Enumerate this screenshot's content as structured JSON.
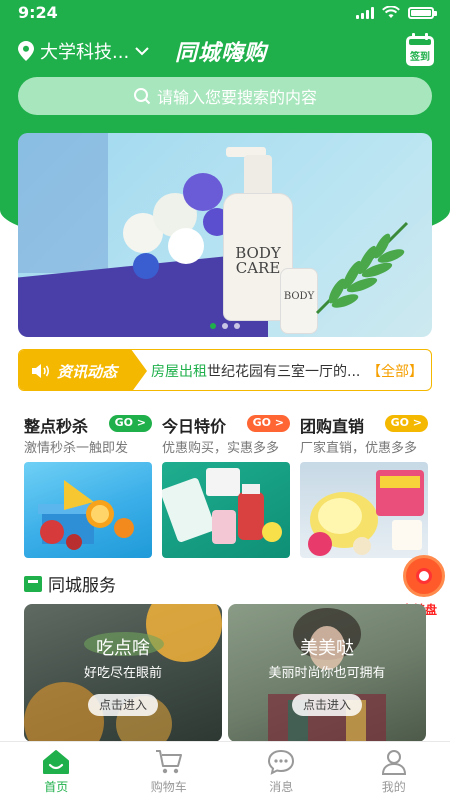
{
  "status_bar": {
    "time": "9:24"
  },
  "header": {
    "location": "大学科技...",
    "app_title": "同城嗨购",
    "signin_label": "签到"
  },
  "search": {
    "placeholder": "请输入您要搜索的内容"
  },
  "banner": {
    "product_label_1": "BODY CARE",
    "product_label_2": "BODY",
    "slide_count": 3,
    "active_slide": 1
  },
  "news": {
    "tag": "资讯动态",
    "highlight": "房屋出租",
    "text": "世纪花园有三室一厅的...",
    "more": "【全部】"
  },
  "promos": [
    {
      "title": "整点秒杀",
      "go": "GO >",
      "subtitle": "激情秒杀一触即发",
      "go_color": "#20b04b"
    },
    {
      "title": "今日特价",
      "go": "GO >",
      "subtitle": "优惠购买，实惠多多",
      "go_color": "#ff6633"
    },
    {
      "title": "团购直销",
      "go": "GO >",
      "subtitle": "厂家直销，优惠多多",
      "go_color": "#f5b800"
    }
  ],
  "service": {
    "title": "同城服务",
    "cards": [
      {
        "title": "吃点啥",
        "subtitle": "好吃尽在眼前",
        "button": "点击进入"
      },
      {
        "title": "美美哒",
        "subtitle": "美丽时尚你也可拥有",
        "button": "点击进入"
      }
    ]
  },
  "float_widget": {
    "label": "大转盘"
  },
  "tabbar": {
    "items": [
      {
        "label": "首页",
        "icon": "home-icon",
        "active": true
      },
      {
        "label": "购物车",
        "icon": "cart-icon",
        "active": false
      },
      {
        "label": "消息",
        "icon": "message-icon",
        "active": false
      },
      {
        "label": "我的",
        "icon": "profile-icon",
        "active": false
      }
    ]
  },
  "colors": {
    "brand": "#20b04b",
    "news_accent": "#f5b800",
    "wheel": "#ff5a2a"
  }
}
